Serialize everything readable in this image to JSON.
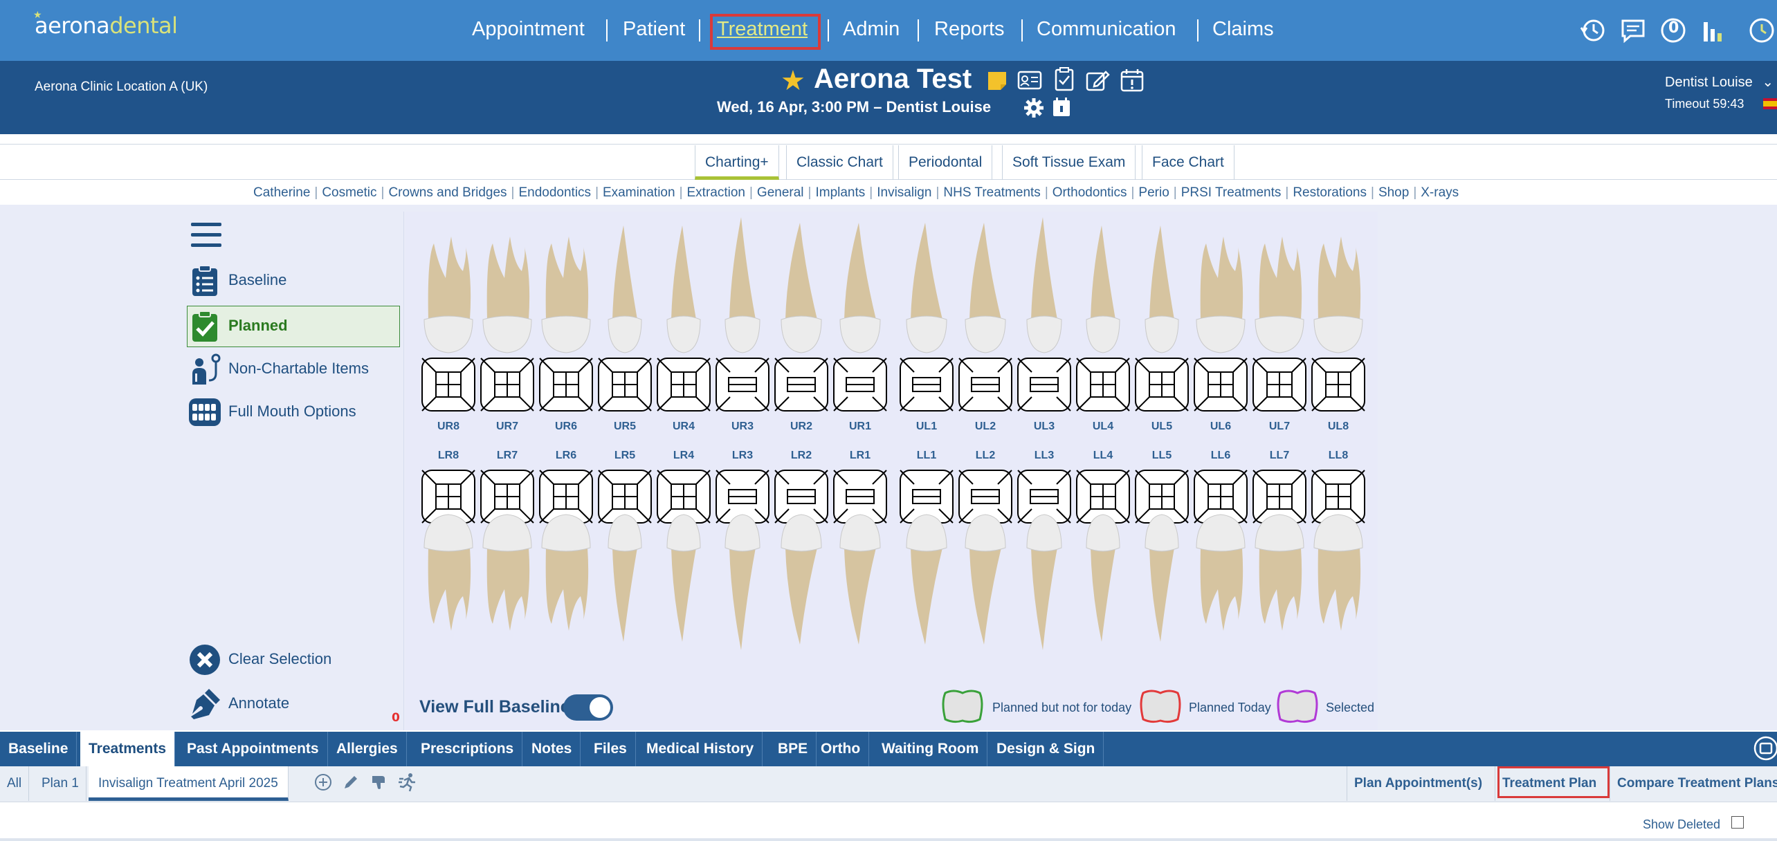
{
  "app": {
    "logo_a": "aerona",
    "logo_b": "dental"
  },
  "nav": {
    "items": [
      "Appointment",
      "Patient",
      "Treatment",
      "Admin",
      "Reports",
      "Communication",
      "Claims"
    ],
    "active": "Treatment",
    "icons": [
      "history-icon",
      "messages-icon",
      "notifications-icon",
      "stats-icon",
      "clock-icon"
    ],
    "notification_count": "0"
  },
  "patient_header": {
    "clinic": "Aerona Clinic Location A (UK)",
    "patient_name": "Aerona Test",
    "appointment": "Wed, 16 Apr, 3:00 PM – Dentist Louise",
    "user": "Dentist Louise",
    "timeout": "Timeout 59:43",
    "icons": [
      "note-icon",
      "id-card-icon",
      "clipboard-check-icon",
      "edit-icon",
      "calendar-alert-icon",
      "settings-icon",
      "calendar-icon"
    ]
  },
  "chart_tabs": {
    "items": [
      "Charting+",
      "Classic Chart",
      "Periodontal",
      "Soft Tissue Exam",
      "Face Chart"
    ],
    "active": "Charting+"
  },
  "categories": [
    "Catherine",
    "Cosmetic",
    "Crowns and Bridges",
    "Endodontics",
    "Examination",
    "Extraction",
    "General",
    "Implants",
    "Invisalign",
    "NHS Treatments",
    "Orthodontics",
    "Perio",
    "PRSI Treatments",
    "Restorations",
    "Shop",
    "X-rays"
  ],
  "left_panel": {
    "baseline": "Baseline",
    "planned": "Planned",
    "non_chartable": "Non-Chartable Items",
    "full_mouth": "Full Mouth Options",
    "clear_selection": "Clear Selection",
    "annotate": "Annotate",
    "annotate_count": "0"
  },
  "teeth": {
    "upper": [
      "UR8",
      "UR7",
      "UR6",
      "UR5",
      "UR4",
      "UR3",
      "UR2",
      "UR1",
      "UL1",
      "UL2",
      "UL3",
      "UL4",
      "UL5",
      "UL6",
      "UL7",
      "UL8"
    ],
    "lower": [
      "LR8",
      "LR7",
      "LR6",
      "LR5",
      "LR4",
      "LR3",
      "LR2",
      "LR1",
      "LL1",
      "LL2",
      "LL3",
      "LL4",
      "LL5",
      "LL6",
      "LL7",
      "LL8"
    ]
  },
  "chart_footer": {
    "view_full_baseline": "View Full Baseline",
    "toggle_on": true,
    "legend": [
      {
        "label": "Planned but not for today",
        "color": "#3aa13a"
      },
      {
        "label": "Planned Today",
        "color": "#e23a3a"
      },
      {
        "label": "Selected",
        "color": "#b13ad6"
      }
    ]
  },
  "bottom_tabs": {
    "items": [
      "Baseline",
      "Treatments",
      "Past Appointments",
      "Allergies",
      "Prescriptions",
      "Notes",
      "Files",
      "Medical History",
      "BPE",
      "Ortho",
      "Waiting Room",
      "Design & Sign"
    ],
    "active": "Treatments"
  },
  "plan_tabs": {
    "items": [
      "All",
      "Plan 1",
      "Invisalign Treatment April 2025"
    ],
    "active": "Invisalign Treatment April 2025",
    "actions": [
      "add-icon",
      "pencil-icon",
      "thumbs-down-icon",
      "run-icon"
    ],
    "right": [
      "Plan Appointment(s)",
      "Treatment Plan",
      "Compare Treatment Plans"
    ],
    "show_deleted": "Show Deleted"
  },
  "colors": {
    "topbar": "#3f86c9",
    "patbar": "#20538a",
    "accent_green": "#a9c236",
    "highlight_red": "#d93a3a"
  }
}
